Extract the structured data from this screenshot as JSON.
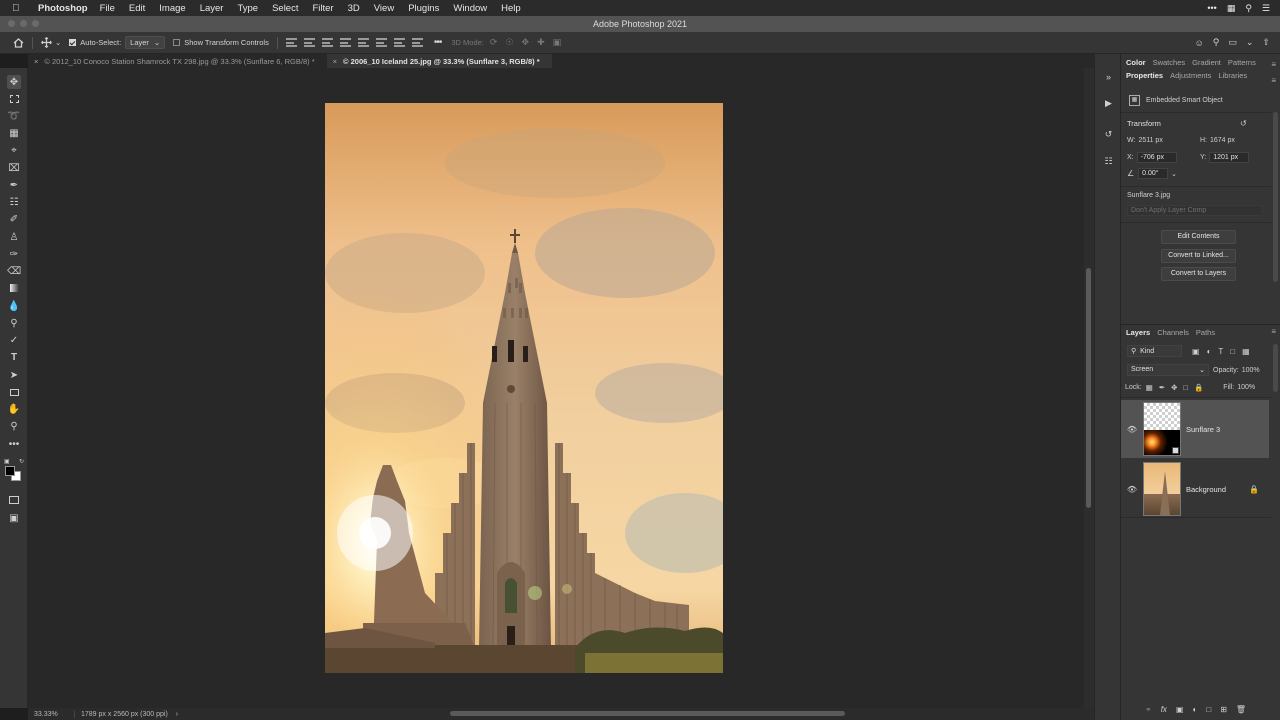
{
  "menubar": {
    "app_name": "Photoshop",
    "items": [
      "File",
      "Edit",
      "Image",
      "Layer",
      "Type",
      "Select",
      "Filter",
      "3D",
      "View",
      "Plugins",
      "Window",
      "Help"
    ]
  },
  "window": {
    "title": "Adobe Photoshop 2021"
  },
  "options_bar": {
    "auto_select_label": "Auto-Select:",
    "auto_select_value": "Layer",
    "transform_controls_label": "Show Transform Controls",
    "mode_3d_label": "3D Mode:"
  },
  "document_tabs": [
    {
      "label": "© 2012_10 Conoco Station Shamrock TX 298.jpg @ 33.3% (Sunflare 6, RGB/8) *",
      "active": false
    },
    {
      "label": "© 2006_10 Iceland 25.jpg @ 33.3% (Sunflare 3, RGB/8) *",
      "active": true
    }
  ],
  "status_bar": {
    "zoom": "33.33%",
    "doc_info": "1789 px x 2560 px (300 ppi)"
  },
  "top_panel": {
    "tabs": [
      "Color",
      "Swatches",
      "Gradient",
      "Patterns"
    ],
    "active_tab": "Color"
  },
  "properties_panel": {
    "tabs": [
      "Properties",
      "Adjustments",
      "Libraries"
    ],
    "active_tab": "Properties",
    "object_type": "Embedded Smart Object",
    "transform_heading": "Transform",
    "w_label": "W:",
    "w_value": "2511 px",
    "h_label": "H:",
    "h_value": "1674 px",
    "x_label": "X:",
    "x_value": "-706 px",
    "y_label": "Y:",
    "y_value": "1201 px",
    "angle_value": "0.00°",
    "file_name": "Sunflare 3.jpg",
    "layer_comp": "Don't Apply Layer Comp",
    "buttons": [
      "Edit Contents",
      "Convert to Linked...",
      "Convert to Layers"
    ]
  },
  "layers_panel": {
    "tabs": [
      "Layers",
      "Channels",
      "Paths"
    ],
    "active_tab": "Layers",
    "filter_label": "Kind",
    "blend_mode": "Screen",
    "opacity_label": "Opacity:",
    "opacity_value": "100%",
    "lock_label": "Lock:",
    "fill_label": "Fill:",
    "fill_value": "100%",
    "layers": [
      {
        "name": "Sunflare 3",
        "selected": true,
        "visible": true
      },
      {
        "name": "Background",
        "selected": false,
        "visible": true,
        "locked": true
      }
    ]
  },
  "colors": {
    "accent_selected_layer": "#535353",
    "panel_bg": "#353535",
    "canvas_bg": "#282828"
  }
}
